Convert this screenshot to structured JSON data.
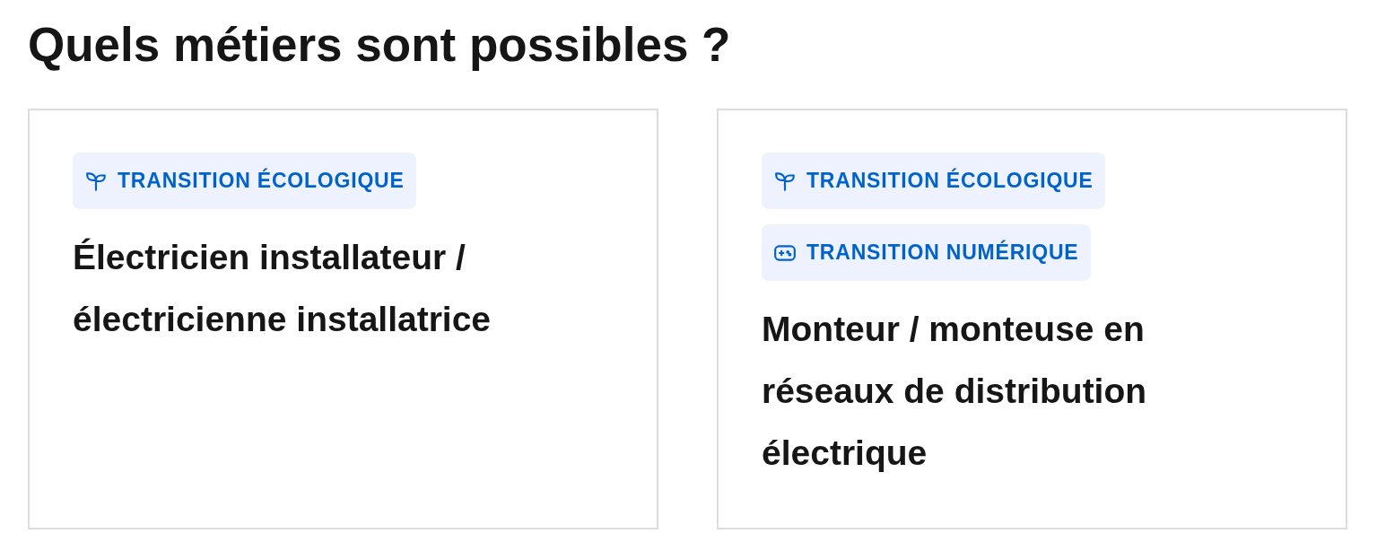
{
  "heading": "Quels métiers sont possibles ?",
  "cards": [
    {
      "tags": [
        {
          "kind": "ecology",
          "label": "TRANSITION ÉCOLOGIQUE"
        }
      ],
      "title": "Électricien installateur / électricienne installatrice"
    },
    {
      "tags": [
        {
          "kind": "ecology",
          "label": "TRANSITION ÉCOLOGIQUE"
        },
        {
          "kind": "digital",
          "label": "TRANSITION NUMÉRIQUE"
        }
      ],
      "title": "Monteur / monteuse en réseaux de distribution électrique"
    }
  ]
}
